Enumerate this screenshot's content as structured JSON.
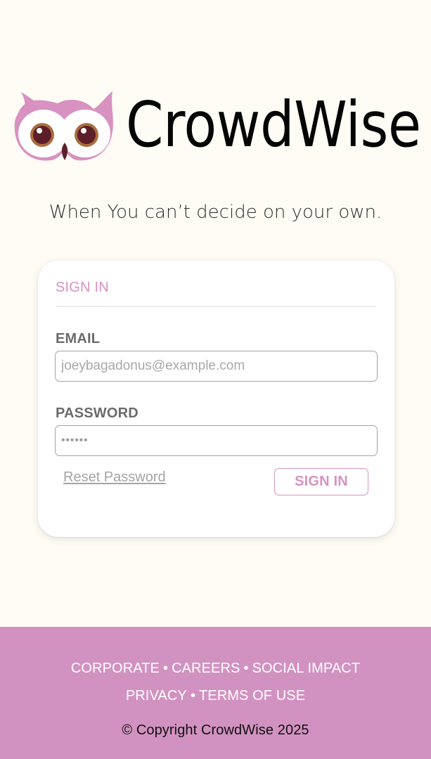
{
  "brand": {
    "name": "CrowdWise",
    "logo_icon": "owl-icon",
    "tagline": "When You can’t decide on your own."
  },
  "sign_in_card": {
    "title": "SIGN IN",
    "email_label": "EMAIL",
    "email_placeholder": "joeybagadonus@example.com",
    "password_label": "PASSWORD",
    "password_value": "••••••",
    "reset_password": "Reset Password",
    "submit_label": "SIGN IN"
  },
  "footer": {
    "links_row_1": [
      "CORPORATE",
      "CAREERS",
      "SOCIAL IMPACT"
    ],
    "links_row_2": [
      "PRIVACY",
      "TERMS OF USE"
    ],
    "separator": "•",
    "copyright": "© Copyright CrowdWise 2025"
  },
  "colors": {
    "background": "#fffcf5",
    "accent": "#d792c1",
    "footer": "#d292c1",
    "text": "#050505"
  }
}
